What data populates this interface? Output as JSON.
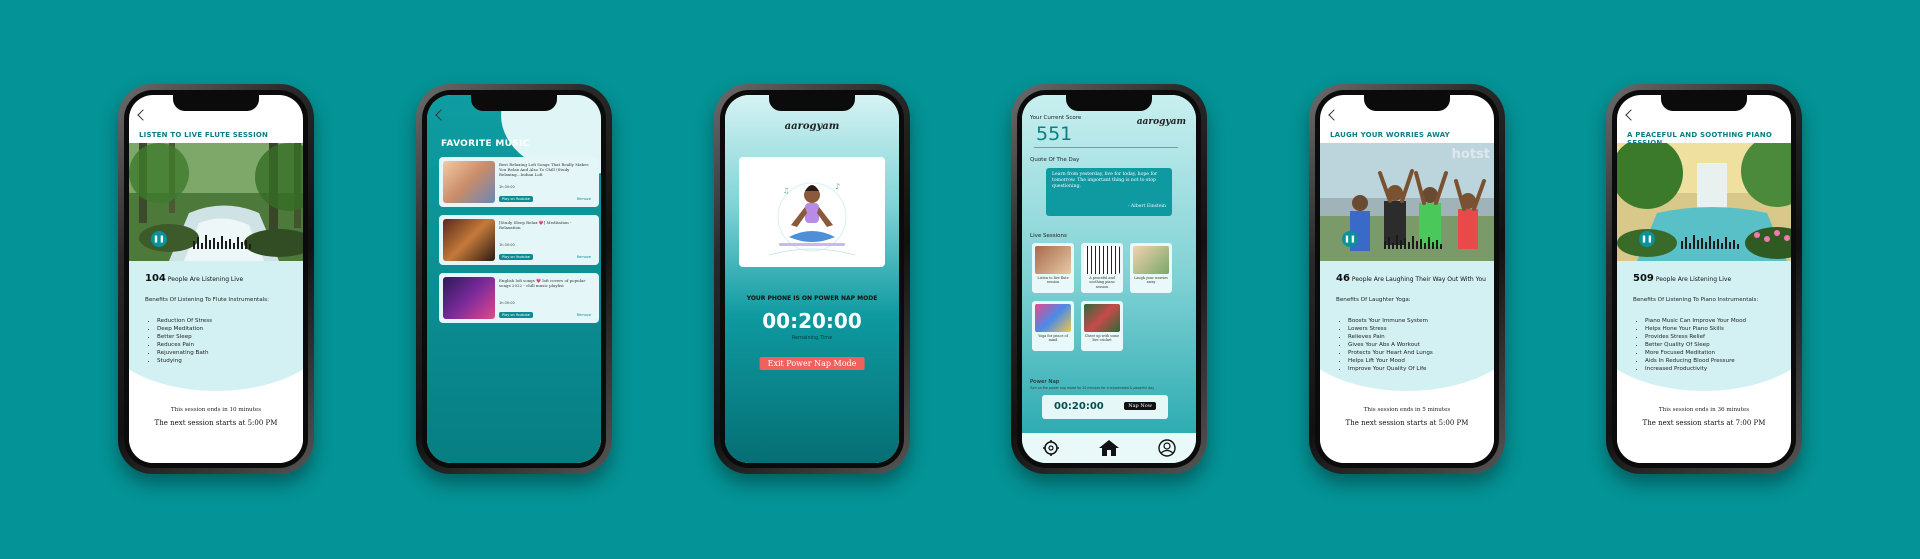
{
  "phones": [
    {
      "title": "LISTEN TO LIVE FLUTE SESSION",
      "count": "104",
      "count_text": "People Are Listening Live",
      "benefits_heading": "Benefits Of Listening To Flute Instrumentals:",
      "benefits": [
        "Reduction Of Stress",
        "Deep Meditation",
        "Better Sleep",
        "Reduces Pain",
        "Rejuvenating Bath",
        "Studying"
      ],
      "session_ends": "This session ends in 10 minutes",
      "next_session": "The next session starts at 5:00 PM"
    },
    {
      "title": "FAVORITE MUSIC",
      "cards": [
        {
          "text": "Best Relaxing Lofi Songs That Really Makes You Relax And Also To Chill (Study Relaxing...Indian Lofi",
          "duration": "1h:30:00",
          "play": "Play on Youtube",
          "remove": "Remove"
        },
        {
          "text": "[Study Sleep Relax 💗] Meditation - Relaxation",
          "duration": "1h:30:00",
          "play": "Play on Youtube",
          "remove": "Remove"
        },
        {
          "text": "English lofi songs 💗 lofi covers of popular songs 2022 - chill music playlist",
          "duration": "1h:30:00",
          "play": "Play on Youtube",
          "remove": "Remove"
        }
      ]
    },
    {
      "logo": "aarogyam",
      "message": "YOUR PHONE IS ON POWER NAP MODE",
      "timer": "00:20:00",
      "remaining": "Remaining Time",
      "exit_button": "Exit Power Nap Mode"
    },
    {
      "score_label": "Your Current Score",
      "score": "551",
      "logo": "aarogyam",
      "quote_label": "Quote Of The Day",
      "quote": "Learn from yesterday, live for today, hope for tomorrow. The important thing is not to stop questioning.",
      "quote_author": "- Albert Einstein",
      "live_label": "Live Sessions",
      "sessions": [
        "Listen to live flute session",
        "A peaceful and soothing piano session",
        "Laugh your worries away",
        "Yoga for peace of mind",
        "Cheer up with some live cricket"
      ],
      "power_nap_label": "Power Nap",
      "power_nap_sub": "Turn on the power nap mode for 20 minutes for a rejuvenated & powerful day",
      "power_nap_time": "00:20:00",
      "nap_button": "Nap Now"
    },
    {
      "title": "LAUGH YOUR WORRIES AWAY",
      "watermark": "hotst",
      "count": "46",
      "count_text": "People Are Laughing Their Way Out With You",
      "benefits_heading": "Benefits Of Laughter Yoga:",
      "benefits": [
        "Boosts Your Immune System",
        "Lowers Stress",
        "Relieves Pain",
        "Gives Your Abs A Workout",
        "Protects Your Heart And Lungs",
        "Helps Lift Your Mood",
        "Improve Your Quality Of Life"
      ],
      "session_ends": "This session ends in 5 minutes",
      "next_session": "The next session starts at 5:00 PM"
    },
    {
      "title": "A PEACEFUL AND SOOTHING PIANO SESSION",
      "count": "509",
      "count_text": "People Are Listening Live",
      "benefits_heading": "Benefits Of Listening To Piano Instrumentals:",
      "benefits": [
        "Piano Music Can Improve Your Mood",
        "Helps Hone Your Piano Skills",
        "Provides Stress Relief",
        "Better Quality Of Sleep",
        "More Focused Meditation",
        "Aids In Reducing Blood Pressure",
        "Increased Productivity"
      ],
      "session_ends": "This session ends in 36 minutes",
      "next_session": "The next session starts at 7:00 PM"
    }
  ],
  "colors": {
    "background": "#049396",
    "accent": "#0a8c91",
    "exit": "#f0605d"
  }
}
